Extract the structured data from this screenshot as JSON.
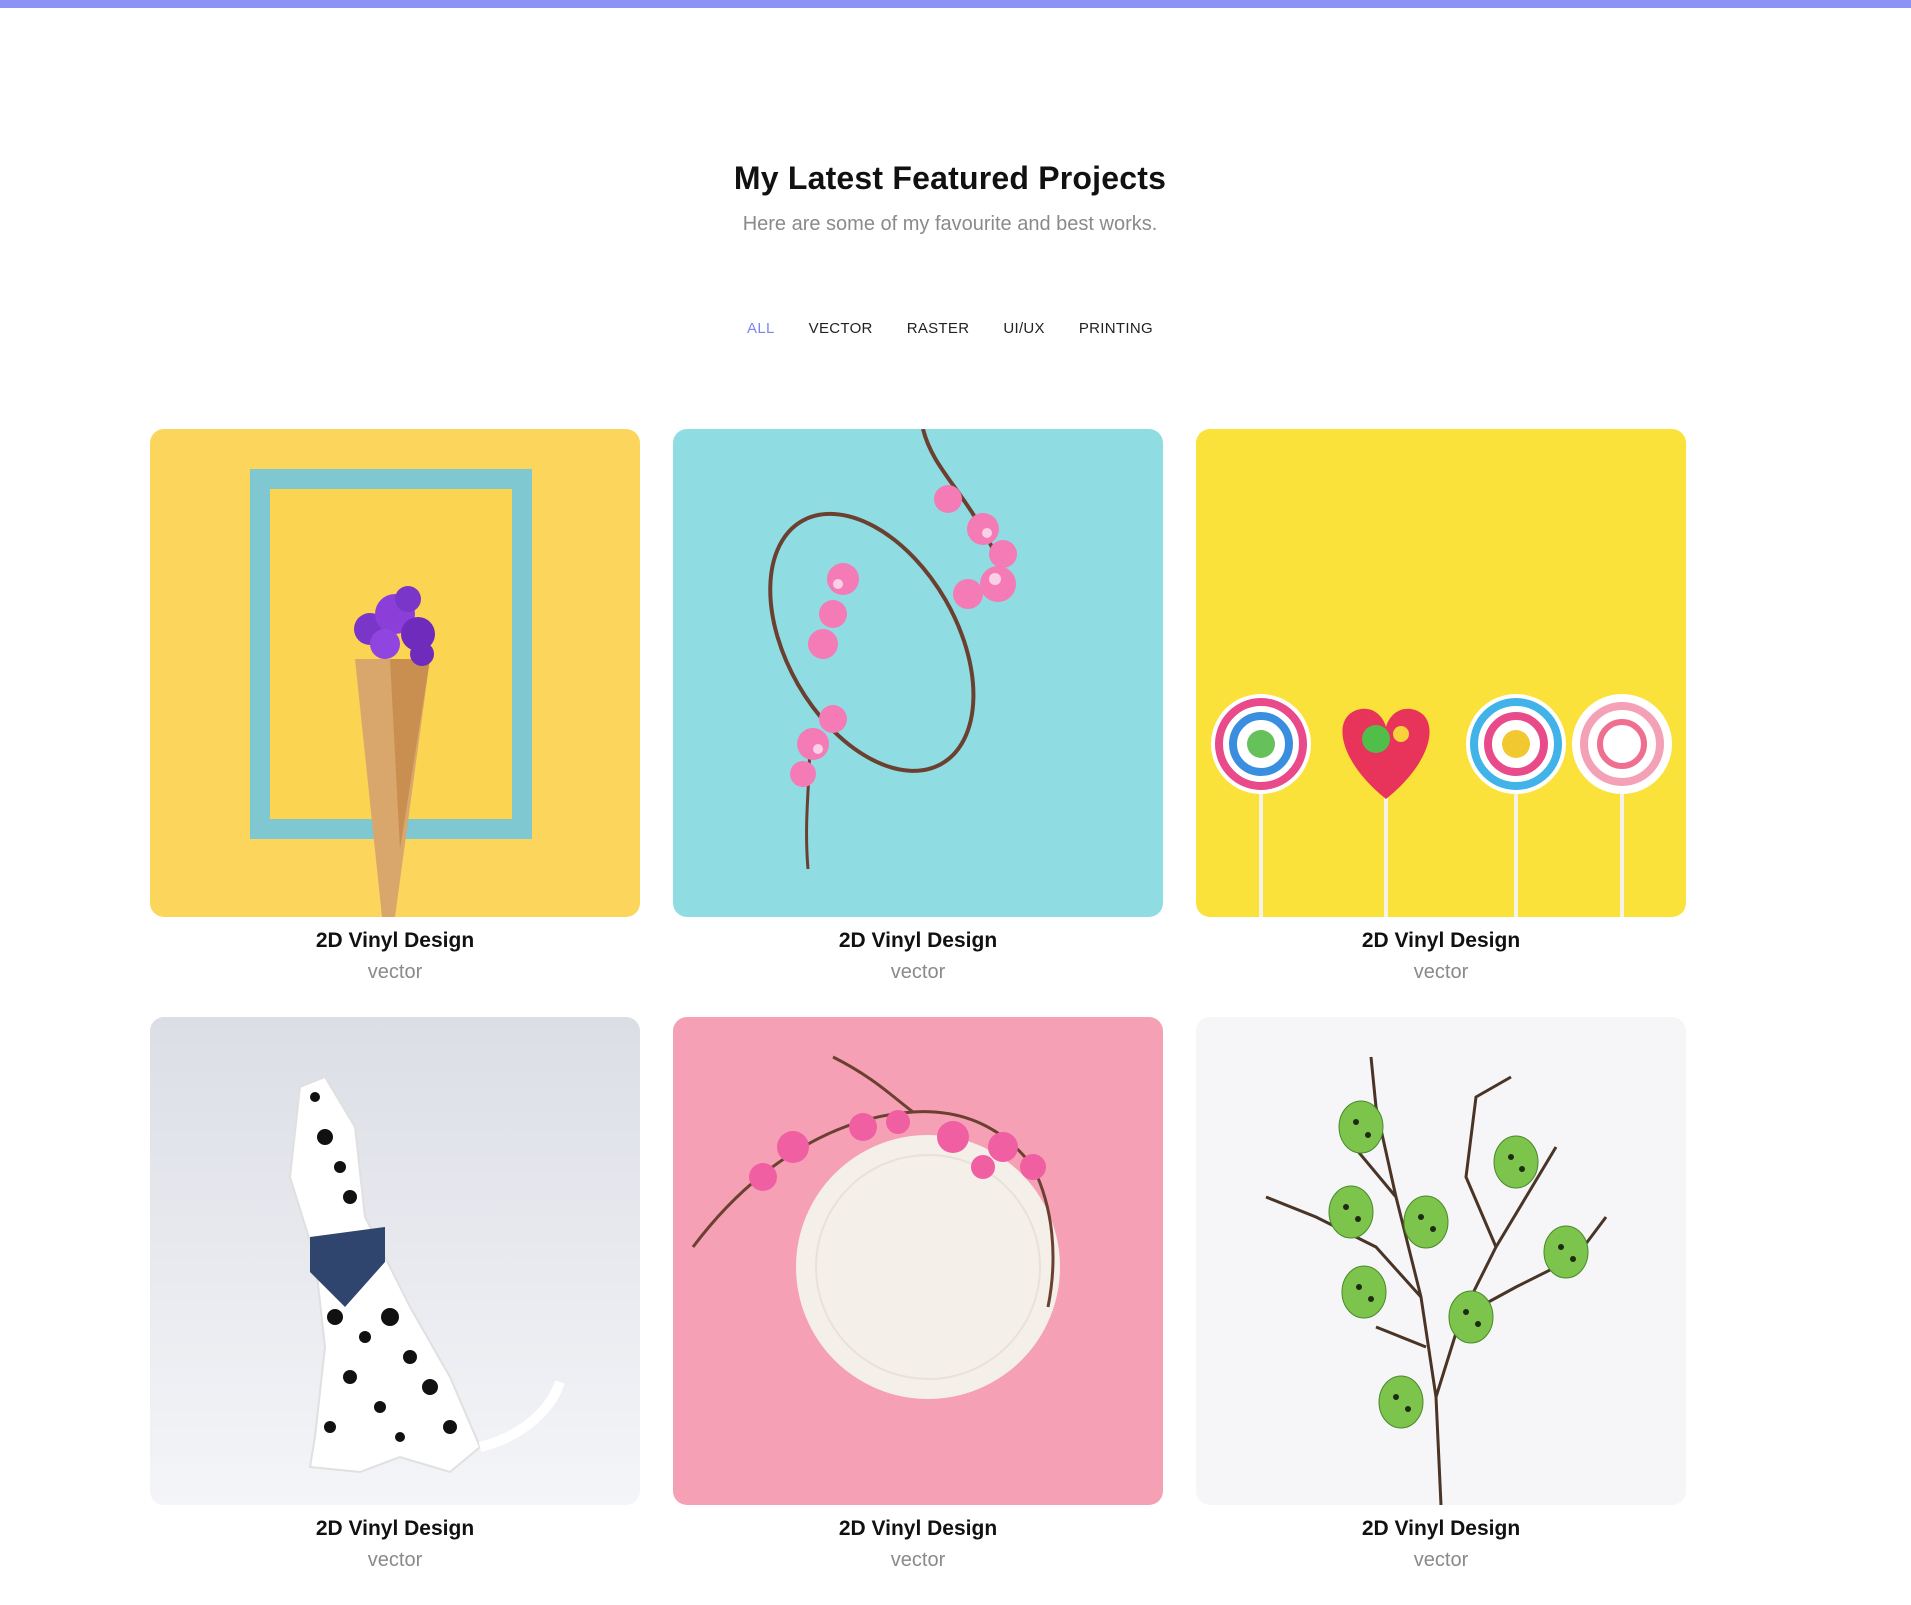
{
  "header": {
    "title": "My Latest Featured Projects",
    "subtitle": "Here are some of my favourite and best works."
  },
  "filters": [
    {
      "label": "ALL",
      "active": true
    },
    {
      "label": "VECTOR",
      "active": false
    },
    {
      "label": "RASTER",
      "active": false
    },
    {
      "label": "UI/UX",
      "active": false
    },
    {
      "label": "PRINTING",
      "active": false
    }
  ],
  "projects": [
    {
      "title": "2D Vinyl Design",
      "category": "vector",
      "image": "flower-cone-in-frame"
    },
    {
      "title": "2D Vinyl Design",
      "category": "vector",
      "image": "flower-wreath-on-blue"
    },
    {
      "title": "2D Vinyl Design",
      "category": "vector",
      "image": "lollipops-on-yellow"
    },
    {
      "title": "2D Vinyl Design",
      "category": "vector",
      "image": "dalmatian-dog"
    },
    {
      "title": "2D Vinyl Design",
      "category": "vector",
      "image": "plate-with-blossoms"
    },
    {
      "title": "2D Vinyl Design",
      "category": "vector",
      "image": "green-eggs-on-branch"
    }
  ],
  "colors": {
    "accent": "#8b93f6",
    "filter_active": "#7b86f0"
  }
}
